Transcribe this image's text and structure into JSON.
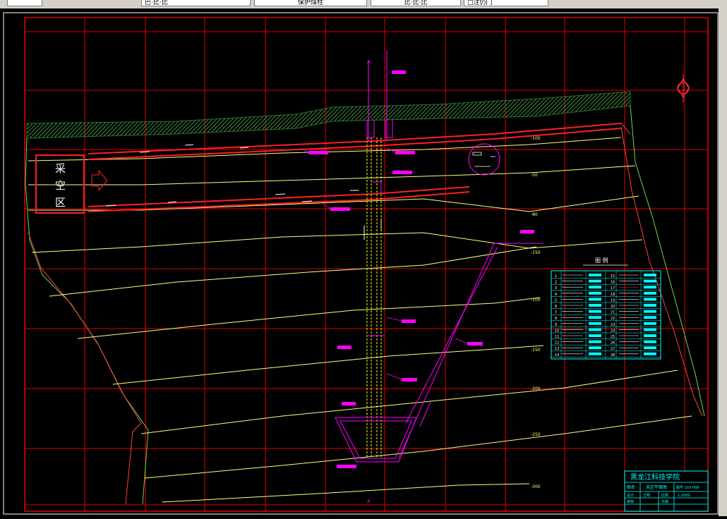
{
  "toolbar": {
    "tabs": [
      "巴·比·比",
      "",
      "保护煤柱",
      "比·比·比",
      "□注仍门"
    ]
  },
  "drawing": {
    "goaf_label_chars": [
      "采",
      "空",
      "区"
    ],
    "section_mark_top": "A",
    "section_mark_bottom": "A",
    "legend": {
      "title": "图   例",
      "row_numbers_left": [
        "1",
        "2",
        "3",
        "4",
        "5",
        "6",
        "7",
        "8",
        "9",
        "10",
        "11",
        "12",
        "13",
        "14"
      ],
      "row_numbers_right": [
        "15",
        "16",
        "17",
        "18",
        "19",
        "20",
        "21",
        "22",
        "23",
        "24",
        "25",
        "26",
        "27",
        "28"
      ]
    },
    "title_block": {
      "institute": "黑龙江科技学院",
      "drawing_name_label": "图名",
      "drawing_name": "采区平面图",
      "row2": [
        "设计",
        "王明",
        "比例",
        "1:2000"
      ],
      "row3": [
        "审核",
        "",
        "日期",
        ""
      ],
      "code": "图号 103-008"
    },
    "contour_labels": [
      "-100",
      "-50",
      "-80",
      "-150",
      "-100",
      "-150",
      "-200",
      "-250",
      "-300"
    ]
  },
  "colors": {
    "grid": "#e00000",
    "contour": "#ffff80",
    "magenta": "#ff00ff",
    "cyan": "#00ffff",
    "green": "#00cc00",
    "yellow": "#ffff00",
    "chrome": "#d4d0c8"
  }
}
